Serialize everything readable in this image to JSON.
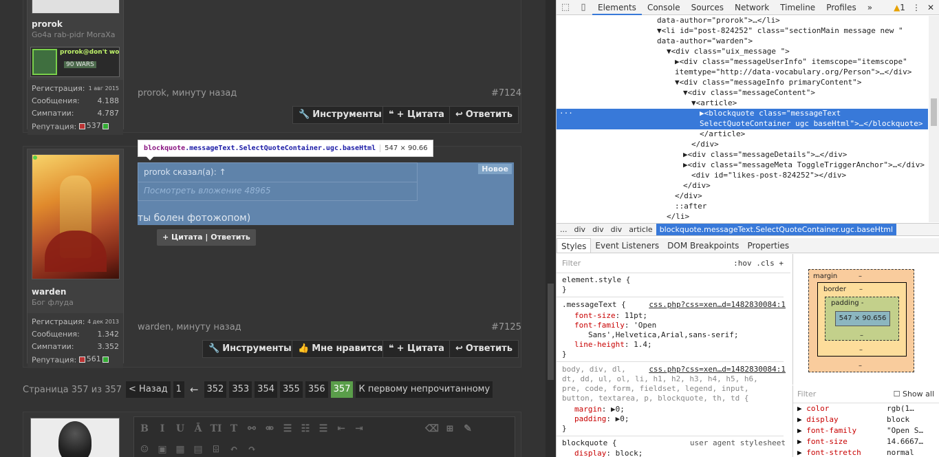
{
  "forum": {
    "post1": {
      "username": "prorok",
      "usertitle": "Go4a rab-pidr MoraXa",
      "signature_text": "prorok@don't wo",
      "signature_sub": "90 WARS",
      "stats": [
        {
          "label": "Регистрация:",
          "value": "1 авг 2015"
        },
        {
          "label": "Сообщения:",
          "value": "4.188"
        },
        {
          "label": "Симпатии:",
          "value": "4.787"
        },
        {
          "label": "Репутация:",
          "value": "537"
        }
      ],
      "author_time": "prorok, минуту назад",
      "post_number": "#7124",
      "buttons": {
        "tools": "Инструменты",
        "quote": "+ Цитата",
        "reply": "Ответить"
      }
    },
    "post2": {
      "username": "warden",
      "usertitle": "Бог флуда",
      "stats": [
        {
          "label": "Регистрация:",
          "value": "4 дек 2013"
        },
        {
          "label": "Сообщения:",
          "value": "1.342"
        },
        {
          "label": "Симпатии:",
          "value": "3.352"
        },
        {
          "label": "Репутация:",
          "value": "561"
        }
      ],
      "quote_author": "prorok сказал(а): ↑",
      "quote_link": "Посмотреть вложение 48965",
      "new_badge": "Новое",
      "message": "ты болен фотожопом)",
      "quote_popup": "+ Цитата | Ответить",
      "author_time": "warden, минуту назад",
      "post_number": "#7125",
      "buttons": {
        "tools": "Инструменты",
        "like": "Мне нравится",
        "quote": "+ Цитата",
        "reply": "Ответить"
      }
    },
    "inspector_tooltip": {
      "tag": "blockquote",
      "classes": ".messageText.SelectQuoteContainer.ugc.baseHtml",
      "size": "547 × 90.66"
    },
    "pagination": {
      "label": "Страница 357 из 357",
      "prev": "< Назад",
      "first": "1",
      "ellipsis": "←",
      "pages": [
        "352",
        "353",
        "354",
        "355",
        "356",
        "357"
      ],
      "active": "357",
      "first_unread": "К первому непрочитанному"
    },
    "editor_toolbar_row1": [
      "B",
      "I",
      "U",
      "Ā",
      "TI",
      "T",
      "⚯",
      "⚮",
      "☰",
      "☷",
      "☰",
      "⇤",
      "⇥",
      "⌫",
      "⊞",
      "✎"
    ],
    "editor_toolbar_row2": [
      "☺",
      "▣",
      "▦",
      "▤",
      "⌹",
      "↶",
      "↷"
    ]
  },
  "devtools": {
    "tabs": [
      "Elements",
      "Console",
      "Sources",
      "Network",
      "Timeline",
      "Profiles",
      "»"
    ],
    "active_tab": "Elements",
    "warning_count": "1",
    "elements": [
      {
        "indent": 146,
        "html": "data-author=\"prorok\">…</li>"
      },
      {
        "indent": 146,
        "html": "▼<li id=\"post-824252\" class=\"sectionMain message    new \""
      },
      {
        "indent": 146,
        "html": "data-author=\"warden\">"
      },
      {
        "indent": 160,
        "html": "▼<div class=\"uix_message \">"
      },
      {
        "indent": 172,
        "html": "▶<div class=\"messageUserInfo\" itemscope=\"itemscope\""
      },
      {
        "indent": 172,
        "html": "itemtype=\"http://data-vocabulary.org/Person\">…</div>"
      },
      {
        "indent": 172,
        "html": "▼<div class=\"messageInfo primaryContent\">"
      },
      {
        "indent": 184,
        "html": "▼<div class=\"messageContent\">"
      },
      {
        "indent": 196,
        "html": "▼<article>"
      },
      {
        "indent": 208,
        "html": "▶<blockquote class=\"messageText"
      },
      {
        "indent": 208,
        "html": "SelectQuoteContainer ugc baseHtml\">…</blockquote>"
      },
      {
        "indent": 208,
        "html": "</article>"
      },
      {
        "indent": 196,
        "html": "</div>"
      },
      {
        "indent": 184,
        "html": "▶<div class=\"messageDetails\">…</div>"
      },
      {
        "indent": 184,
        "html": "▶<div class=\"messageMeta ToggleTriggerAnchor\">…</div>"
      },
      {
        "indent": 196,
        "html": "<div id=\"likes-post-824252\"></div>"
      },
      {
        "indent": 184,
        "html": "</div>"
      },
      {
        "indent": 172,
        "html": "</div>"
      },
      {
        "indent": 172,
        "html": "::after"
      },
      {
        "indent": 160,
        "html": "</li>"
      }
    ],
    "breadcrumbs": [
      "...",
      "div",
      "div",
      "div",
      "article",
      "blockquote.messageText.SelectQuoteContainer.ugc.baseHtml"
    ],
    "styles_tabs": [
      "Styles",
      "Event Listeners",
      "DOM Breakpoints",
      "Properties"
    ],
    "filter_placeholder": "Filter",
    "filter_tools": ":hov  .cls  +",
    "rules": {
      "element_style": "element.style {",
      "close": "}",
      "messageText_selector": ".messageText {",
      "messageText_src": "css.php?css=xen…d=1482830084:1",
      "messageText_props": [
        {
          "k": "font-size",
          "v": "11pt;"
        },
        {
          "k": "font-family",
          "v": "'Open"
        },
        {
          "k": "",
          "v": "Sans',Helvetica,Arial,sans-serif;"
        },
        {
          "k": "line-height",
          "v": "1.4;"
        }
      ],
      "reset_src": "css.php?css=xen…d=1482830084:1",
      "reset_selector_lines": [
        "body, div, dl,",
        "dt, dd, ul, ol, li, h1, h2, h3, h4, h5, h6,",
        "pre, code, form, fieldset, legend, input,",
        "button, textarea, p, blockquote, th, td {"
      ],
      "reset_props": [
        {
          "k": "margin",
          "v": "▶0;"
        },
        {
          "k": "padding",
          "v": "▶0;"
        }
      ],
      "ua_selector": "blockquote {",
      "ua_src": "user agent stylesheet",
      "ua_prop": {
        "k": "display",
        "v": "block;"
      }
    },
    "box_model": {
      "margin": "margin",
      "border": "border",
      "padding": "padding -",
      "content": "547 × 90.656",
      "dash": "–"
    },
    "computed_filter": "Filter",
    "show_all": "Show all",
    "computed": [
      {
        "k": "color",
        "v": "rgb(1…"
      },
      {
        "k": "display",
        "v": "block"
      },
      {
        "k": "font-family",
        "v": "\"Open S…"
      },
      {
        "k": "font-size",
        "v": "14.6667…"
      },
      {
        "k": "font-stretch",
        "v": "normal"
      }
    ]
  }
}
